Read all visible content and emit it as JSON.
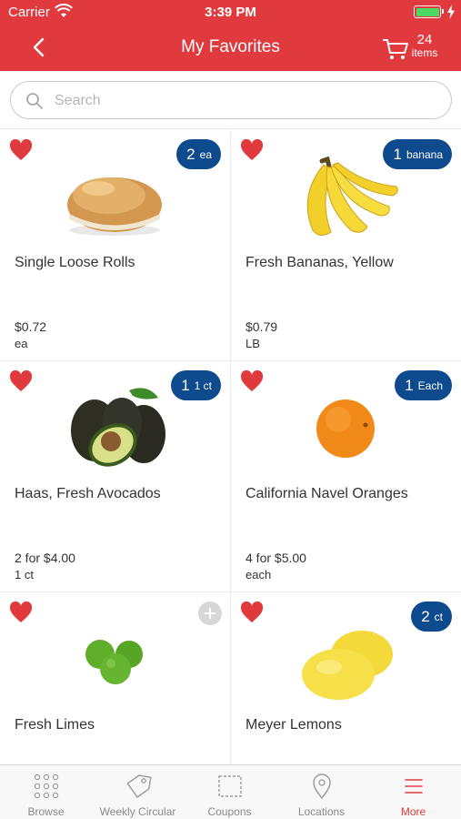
{
  "status_bar": {
    "carrier": "Carrier",
    "time": "3:39 PM"
  },
  "nav": {
    "title": "My Favorites",
    "cart_count": "24",
    "cart_label": "items"
  },
  "search": {
    "placeholder": "Search"
  },
  "products": [
    {
      "name": "Single Loose Rolls",
      "price": "$0.72",
      "unit": "ea",
      "qty": "2",
      "qty_unit": "ea"
    },
    {
      "name": "Fresh Bananas, Yellow",
      "price": "$0.79",
      "unit": "LB",
      "qty": "1",
      "qty_unit": "banana"
    },
    {
      "name": "Haas, Fresh Avocados",
      "price": "2 for $4.00",
      "unit": "1 ct",
      "qty": "1",
      "qty_unit": "1 ct"
    },
    {
      "name": "California Navel Oranges",
      "price": "4 for $5.00",
      "unit": "each",
      "qty": "1",
      "qty_unit": "Each"
    },
    {
      "name": "Fresh Limes",
      "price": "",
      "unit": "",
      "qty": "",
      "qty_unit": ""
    },
    {
      "name": "Meyer Lemons",
      "price": "",
      "unit": "",
      "qty": "2",
      "qty_unit": "ct"
    }
  ],
  "tabs": [
    {
      "label": "Browse",
      "icon": "grid-dots-icon"
    },
    {
      "label": "Weekly Circular",
      "icon": "tag-icon"
    },
    {
      "label": "Coupons",
      "icon": "coupon-icon"
    },
    {
      "label": "Locations",
      "icon": "map-pin-icon"
    },
    {
      "label": "More",
      "icon": "menu-icon"
    }
  ],
  "colors": {
    "brand": "#e03a3e",
    "badge": "#0e4a8e",
    "heart": "#e03a3e"
  }
}
